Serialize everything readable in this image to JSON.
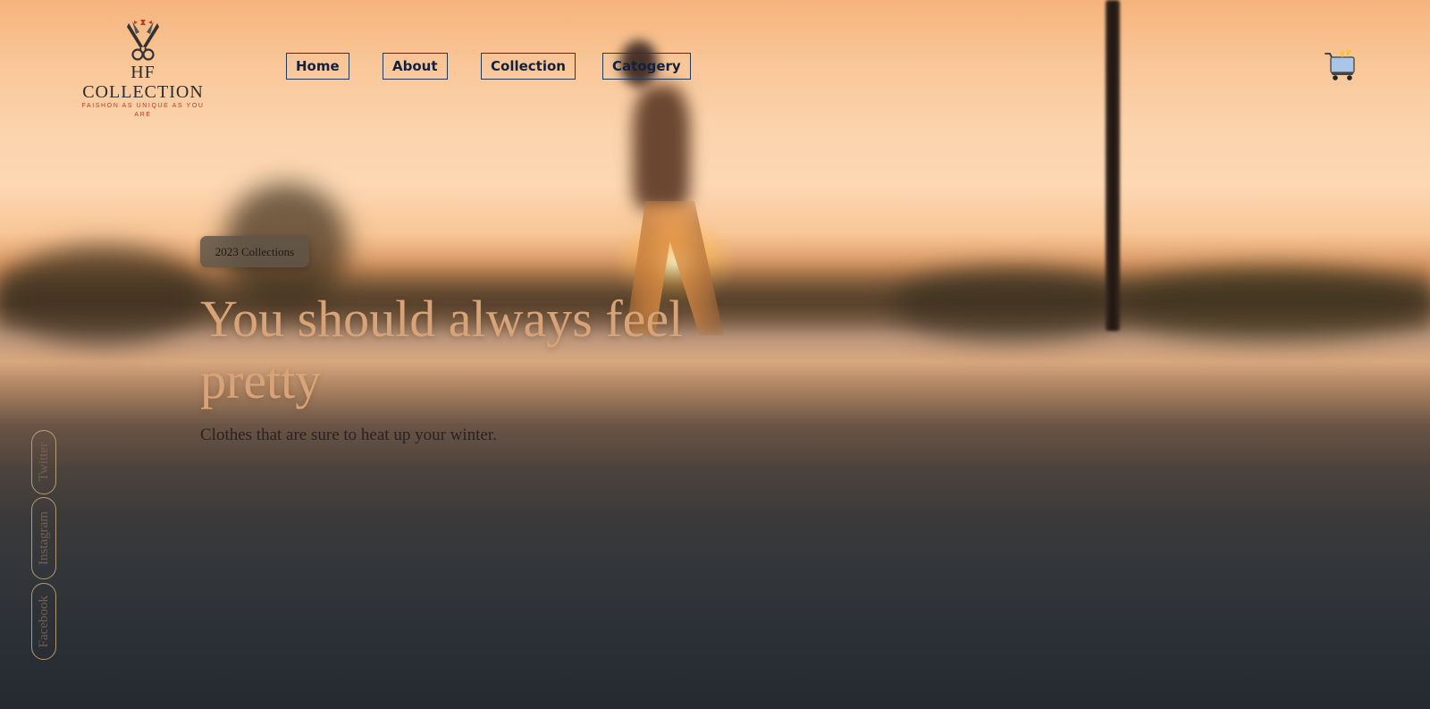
{
  "logo": {
    "brand": "HF COLLECTION",
    "tagline": "FAISHON AS UNIQUE AS YOU ARE",
    "icon": "scissors-bowtie-icon"
  },
  "nav": {
    "items": [
      {
        "label": "Home"
      },
      {
        "label": "About"
      },
      {
        "label": "Collection"
      },
      {
        "label": "Catogery"
      }
    ]
  },
  "cart": {
    "icon": "shopping-cart-icon"
  },
  "hero": {
    "badge": "2023 Collections",
    "headline": "You should always feel pretty",
    "subline": "Clothes that are sure to heat up your winter."
  },
  "social": {
    "items": [
      {
        "label": "Twitter"
      },
      {
        "label": "Instagram"
      },
      {
        "label": "Facebook"
      }
    ]
  },
  "colors": {
    "nav_border": "#1e3a5f",
    "headline": "#d7a47a",
    "tagline": "#c0392b"
  }
}
